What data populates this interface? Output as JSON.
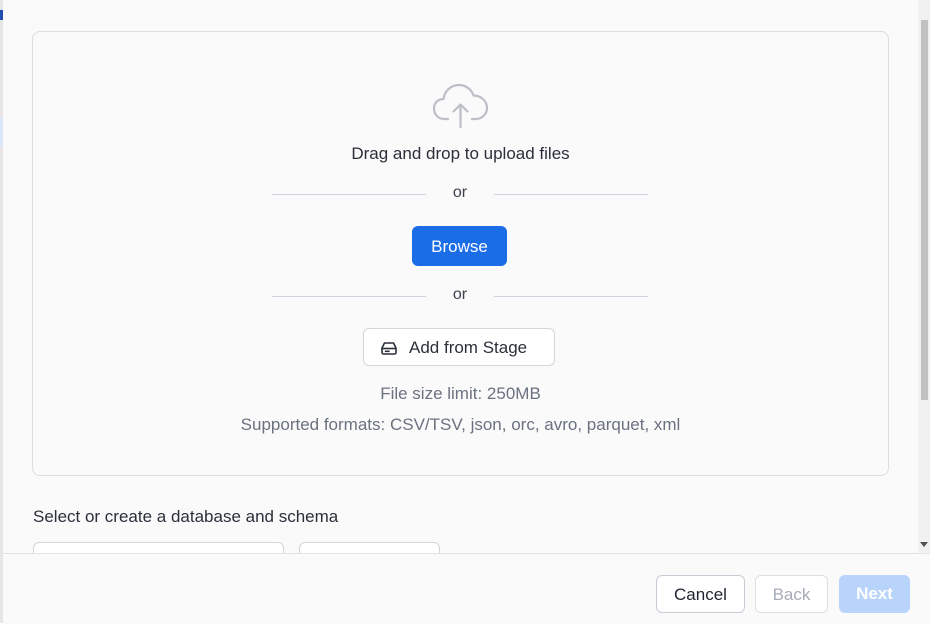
{
  "upload": {
    "drop_title": "Drag and drop to upload files",
    "or_1": "or",
    "browse_label": "Browse",
    "or_2": "or",
    "stage_label": "Add from Stage",
    "size_limit": "File size limit: 250MB",
    "formats": "Supported formats: CSV/TSV, json, orc, avro, parquet, xml",
    "icon": "cloud-upload-icon"
  },
  "section": {
    "label": "Select or create a database and schema"
  },
  "footer": {
    "cancel_label": "Cancel",
    "back_label": "Back",
    "next_label": "Next"
  },
  "colors": {
    "primary": "#1a6ce7",
    "primary_disabled": "#b8d4fb",
    "text": "#2a2f3a",
    "muted": "#6a7180"
  }
}
